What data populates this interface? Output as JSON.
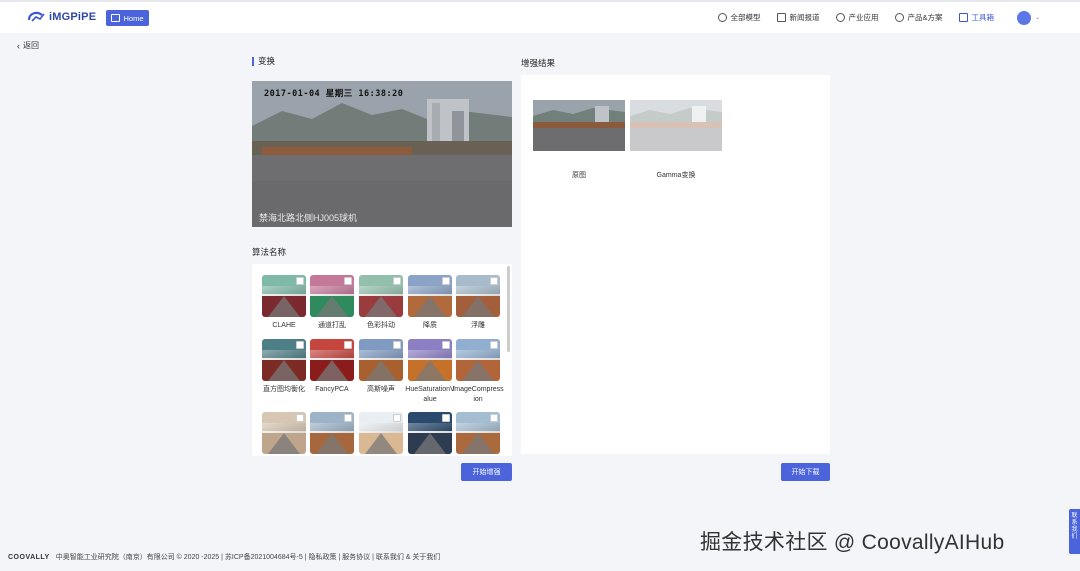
{
  "header": {
    "logo_text": "iMGPiPE",
    "home_label": "Home",
    "nav": [
      {
        "label": "全部模型",
        "icon": "cube-icon",
        "active": false
      },
      {
        "label": "新闻报道",
        "icon": "document-icon",
        "active": false
      },
      {
        "label": "产业应用",
        "icon": "industry-icon",
        "active": false
      },
      {
        "label": "产品&方案",
        "icon": "location-icon",
        "active": false
      },
      {
        "label": "工具箱",
        "icon": "toolbox-icon",
        "active": true
      }
    ]
  },
  "back_label": "返回",
  "transform": {
    "title": "变换",
    "image_timestamp": "2017-01-04  星期三  16:38:20",
    "image_caption": "禁海北路北侧HJ005球机"
  },
  "algorithms": {
    "title": "算法名称",
    "items": [
      {
        "label": "CLAHE",
        "sky": "#7fb9a8",
        "ground": "#7a2a2f",
        "checked": false
      },
      {
        "label": "通道打乱",
        "sky": "#c4789a",
        "ground": "#2f8a5e",
        "checked": false
      },
      {
        "label": "色彩抖动",
        "sky": "#93c0ad",
        "ground": "#9a3b3e",
        "checked": false
      },
      {
        "label": "降质",
        "sky": "#8aa3c6",
        "ground": "#b06a3c",
        "checked": false
      },
      {
        "label": "浮雕",
        "sky": "#a6bccb",
        "ground": "#a35e3b",
        "checked": false
      },
      {
        "label": "直方图均衡化",
        "sky": "#4f7f86",
        "ground": "#7c2b24",
        "checked": false
      },
      {
        "label": "FancyPCA",
        "sky": "#c5453f",
        "ground": "#8a1d1c",
        "checked": false
      },
      {
        "label": "高斯噪声",
        "sky": "#7f9bc2",
        "ground": "#a9602f",
        "checked": false
      },
      {
        "label": "HueSaturationValue",
        "sky": "#8d7fc4",
        "ground": "#c6712a",
        "checked": false
      },
      {
        "label": "ImageCompression",
        "sky": "#90aed0",
        "ground": "#b3653a",
        "checked": false
      },
      {
        "label": "",
        "sky": "#d7c7b2",
        "ground": "#bfa58b",
        "checked": false
      },
      {
        "label": "",
        "sky": "#9db3c8",
        "ground": "#a7673d",
        "checked": false
      },
      {
        "label": "",
        "sky": "#e9eef2",
        "ground": "#d9b893",
        "checked": false
      },
      {
        "label": "",
        "sky": "#2a4a6e",
        "ground": "#2e3c52",
        "checked": false
      },
      {
        "label": "",
        "sky": "#a3bdd1",
        "ground": "#aa6a3e",
        "checked": false
      }
    ],
    "start_label": "开始增强"
  },
  "result": {
    "title": "增强结果",
    "images": [
      {
        "label": "原图"
      },
      {
        "label": "Gamma变换"
      }
    ],
    "download_label": "开始下载"
  },
  "footer": {
    "brand": "COOVALLY",
    "text": "中奥智能工业研究院（南京）有限公司 © 2020 -2025 | 苏ICP备2021004684号-5 | 隐私政策 | 服务协议 | 联系我们  &  关于我们"
  },
  "watermark": "掘金技术社区 @ CoovallyAIHub",
  "side_tab": "联系我们",
  "colors": {
    "accent": "#4b64dc"
  }
}
